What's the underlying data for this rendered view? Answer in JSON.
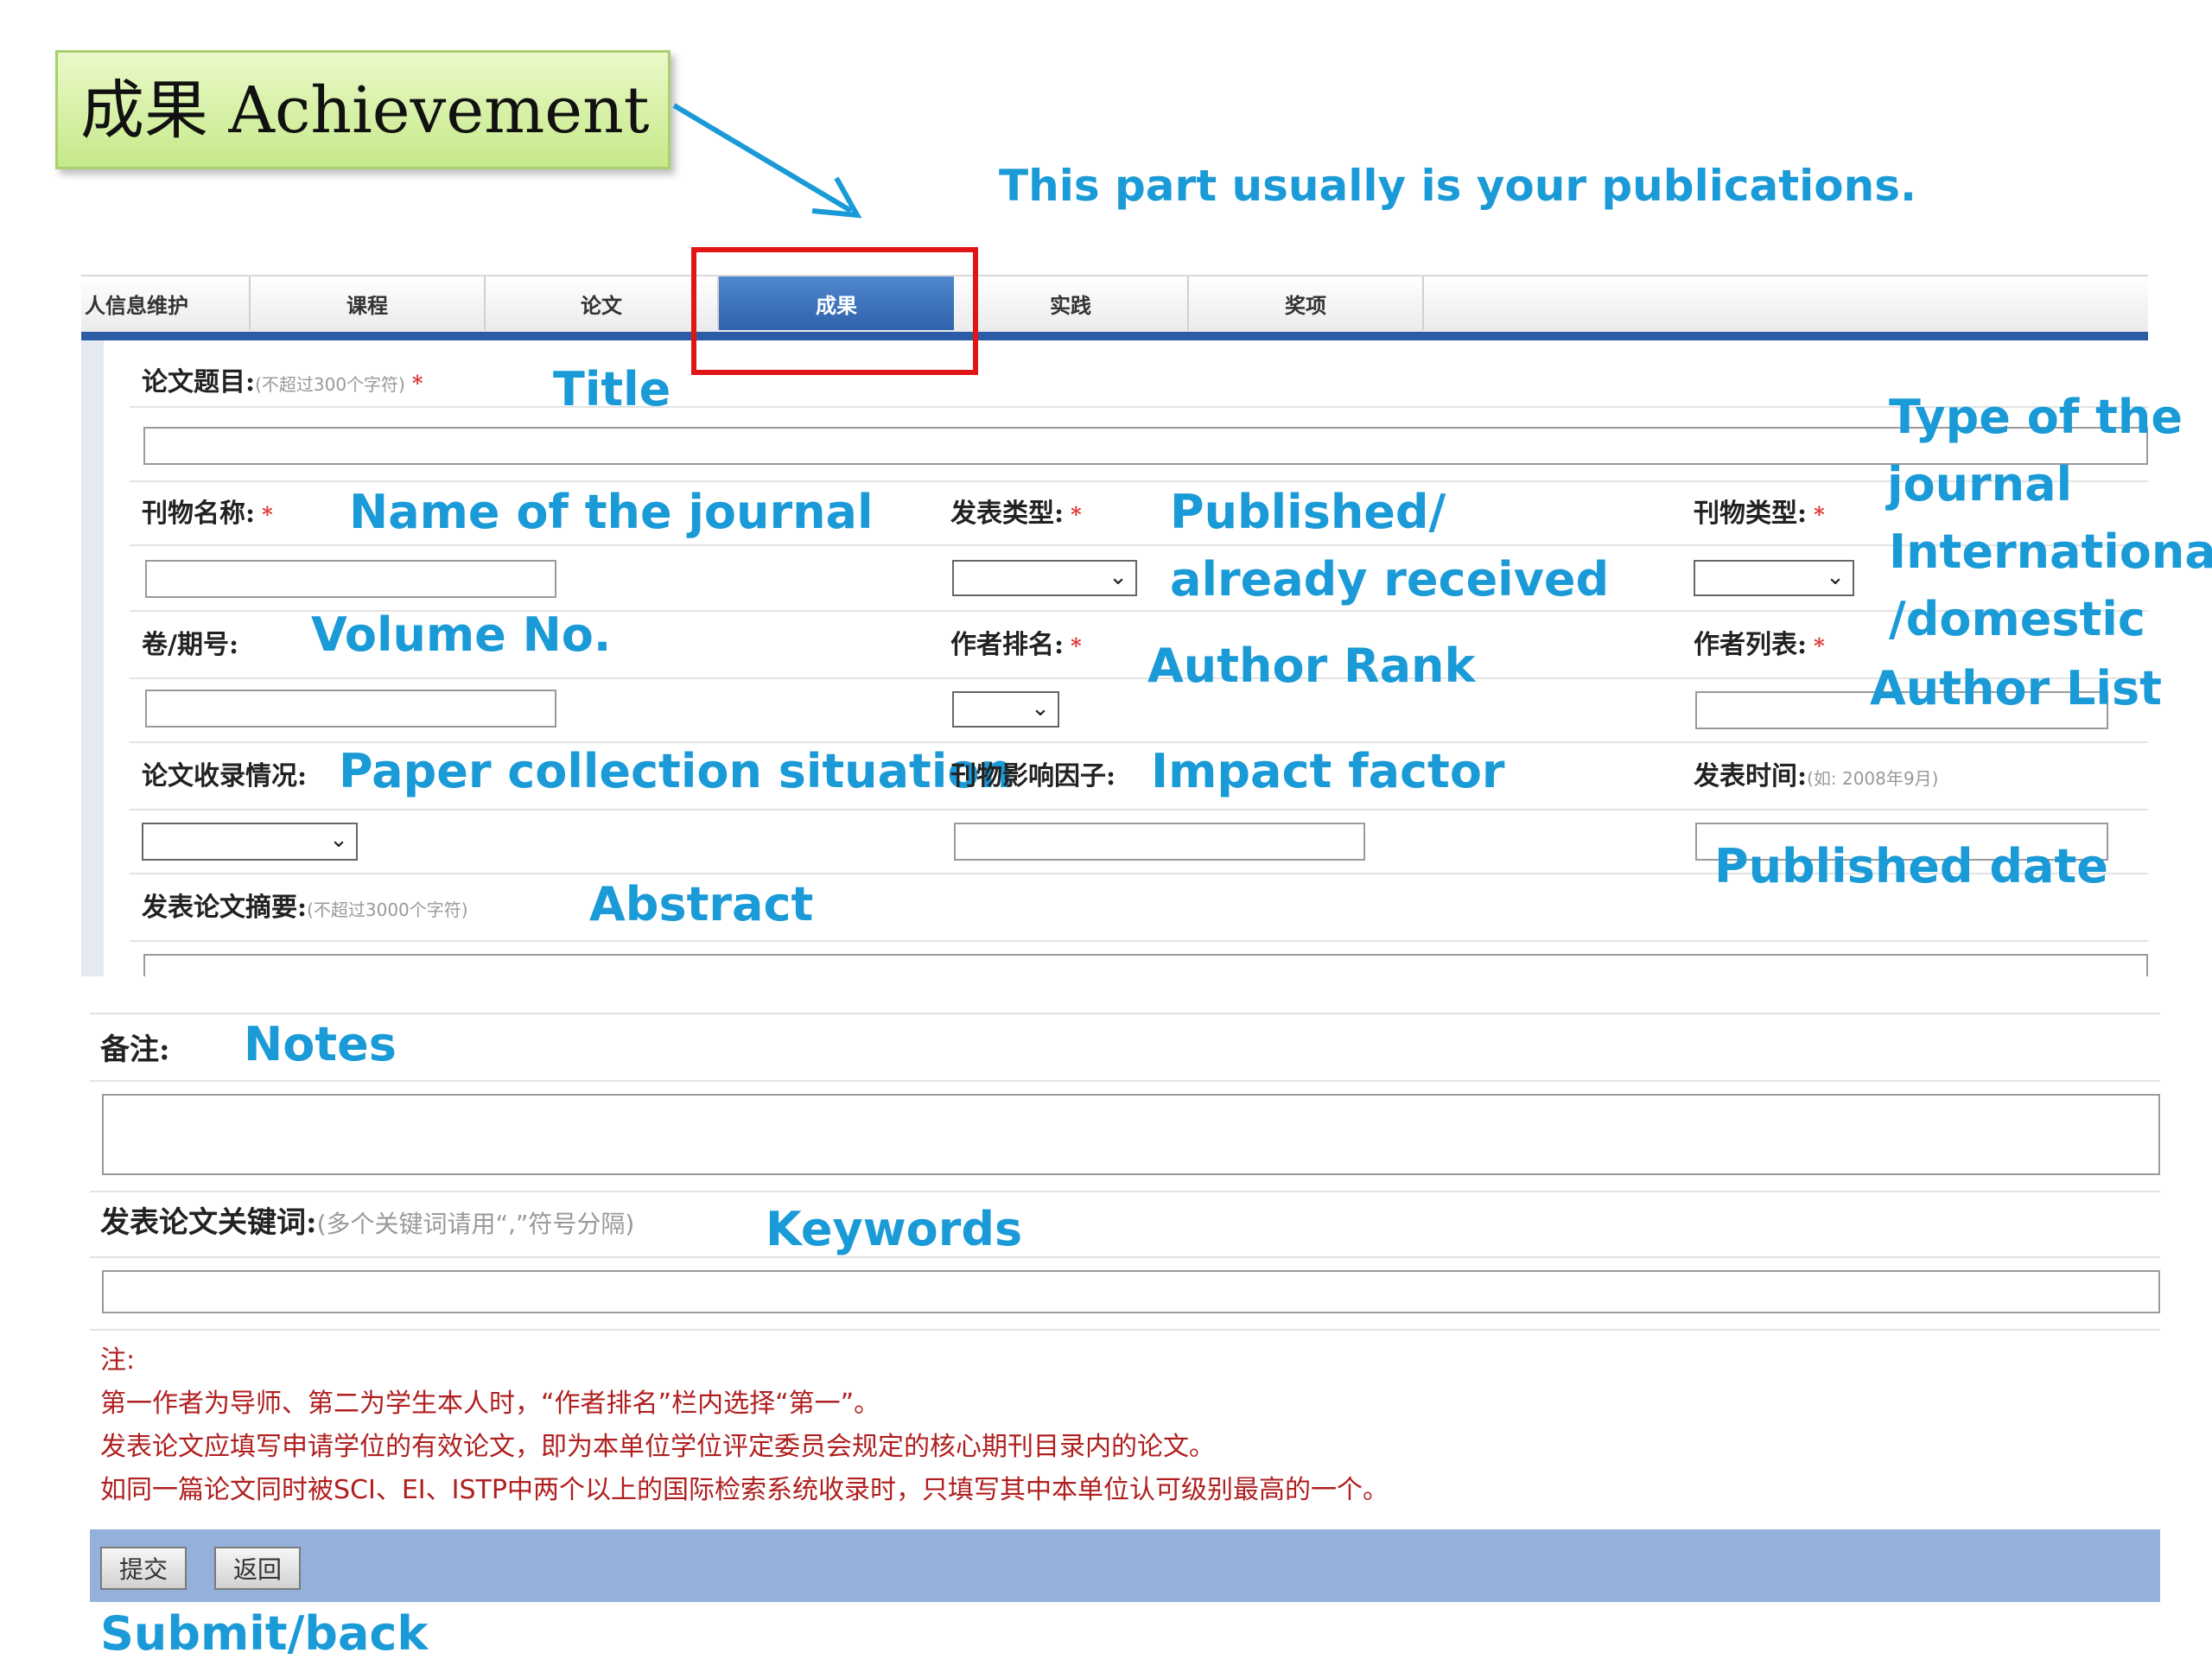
{
  "callout": {
    "achievement_label": "成果 Achievement",
    "publications_note": "This part  usually is your publications."
  },
  "tabs": [
    {
      "label": "人信息维护"
    },
    {
      "label": "课程"
    },
    {
      "label": "论文"
    },
    {
      "label": "成果",
      "active": true
    },
    {
      "label": "实践"
    },
    {
      "label": "奖项"
    }
  ],
  "form": {
    "title": {
      "label": "论文题目:",
      "hint": "(不超过300个字符)",
      "required": "*",
      "annotation": "Title",
      "value": ""
    },
    "journal_name": {
      "label": "刊物名称:",
      "required": "*",
      "annotation": "Name of the journal",
      "value": ""
    },
    "publish_type": {
      "label": "发表类型:",
      "required": "*",
      "annotation_line1": "Published/",
      "annotation_line2": "already received",
      "selected": ""
    },
    "journal_type": {
      "label": "刊物类型:",
      "required": "*",
      "annotation_line1": "Type of the",
      "annotation_line2": "journal",
      "annotation_line3": "International",
      "annotation_line4": "/domestic",
      "selected": ""
    },
    "volume": {
      "label": "卷/期号:",
      "annotation": "Volume No.",
      "value": ""
    },
    "author_rank": {
      "label": "作者排名:",
      "required": "*",
      "annotation": "Author Rank",
      "selected": ""
    },
    "author_list": {
      "label": "作者列表:",
      "required": "*",
      "annotation": "Author List",
      "value": ""
    },
    "collection": {
      "label": "论文收录情况:",
      "annotation": "Paper collection situation",
      "selected": ""
    },
    "impact_factor": {
      "label": "刊物影响因子:",
      "annotation": "Impact factor",
      "value": ""
    },
    "publish_date": {
      "label": "发表时间:",
      "hint": "(如: 2008年9月)",
      "annotation": "Published date",
      "value": ""
    },
    "abstract": {
      "label": "发表论文摘要:",
      "hint": "(不超过3000个字符)",
      "annotation": "Abstract",
      "value": ""
    },
    "notes": {
      "label": "备注:",
      "annotation": "Notes",
      "value": ""
    },
    "keywords": {
      "label": "发表论文关键词:",
      "hint": "(多个关键词请用“,”符号分隔)",
      "annotation": "Keywords",
      "value": ""
    }
  },
  "remarks": {
    "heading": "注:",
    "lines": [
      "第一作者为导师、第二为学生本人时，“作者排名”栏内选择“第一”。",
      "发表论文应填写申请学位的有效论文，即为本单位学位评定委员会规定的核心期刊目录内的论文。",
      "如同一篇论文同时被SCI、EI、ISTP中两个以上的国际检索系统收录时，只填写其中本单位认可级别最高的一个。"
    ]
  },
  "buttons": {
    "submit": "提交",
    "back": "返回",
    "annotation": "Submit/back"
  },
  "colors": {
    "annotation": "#1a9ad6",
    "tab_active": "#2f63ad",
    "highlight": "#e01616",
    "remark_text": "#b01f1f",
    "footer_bar": "#94b1dc"
  }
}
